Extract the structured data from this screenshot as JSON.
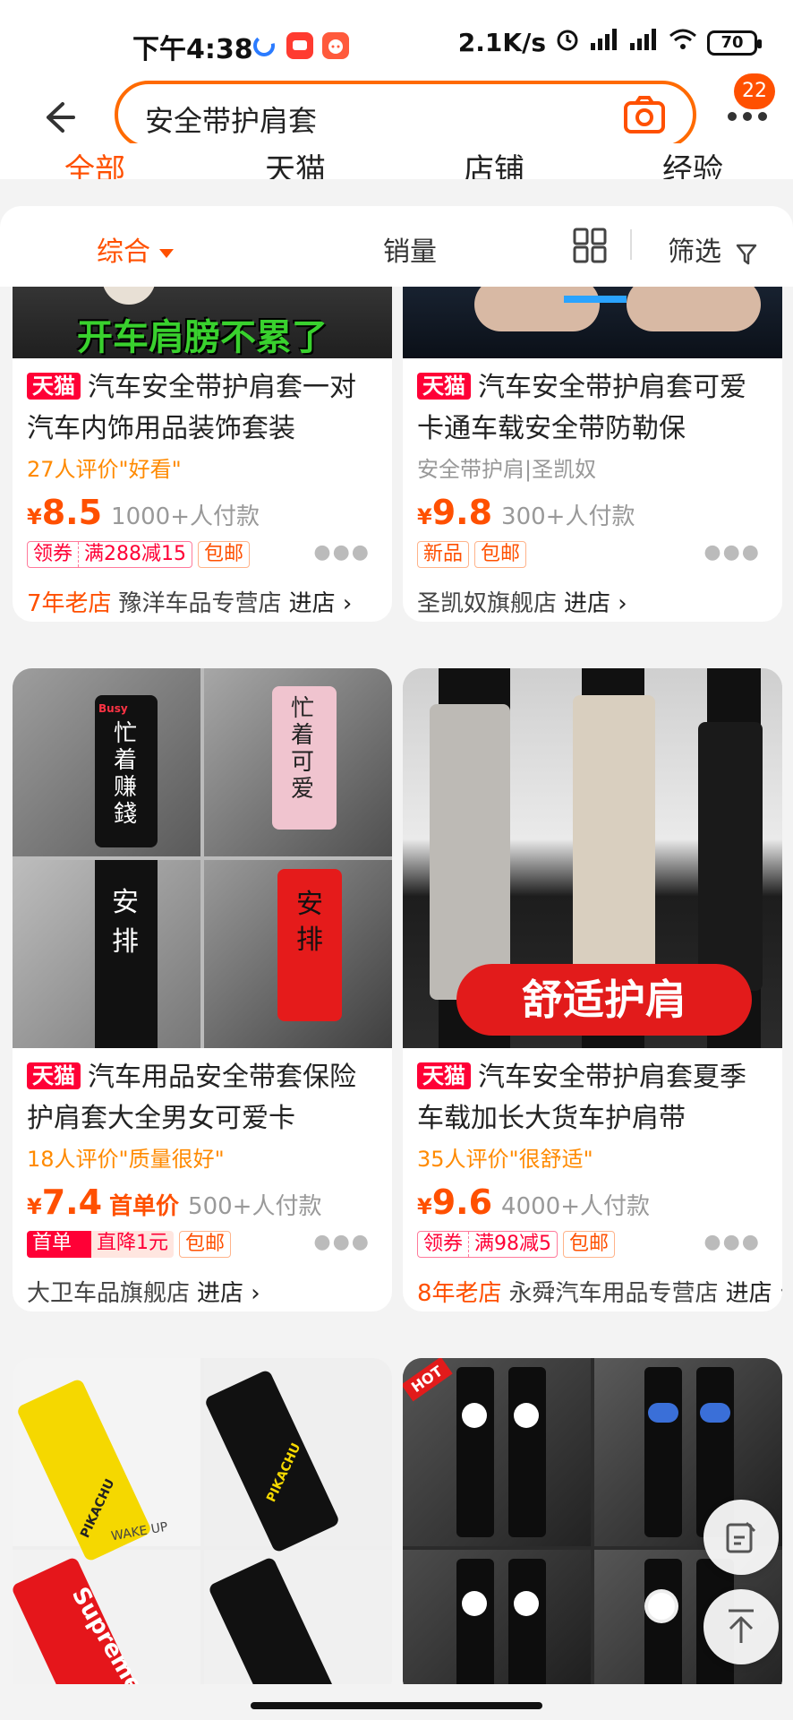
{
  "status_bar": {
    "time": "下午4:38",
    "network_speed": "2.1K/s",
    "battery": "70"
  },
  "search": {
    "query": "安全带护肩套",
    "notification_count": "22"
  },
  "top_tabs": [
    {
      "label": "全部"
    },
    {
      "label": "天猫"
    },
    {
      "label": "店铺"
    },
    {
      "label": "经验"
    }
  ],
  "sort_bar": {
    "comprehensive": "综合",
    "sales": "销量",
    "filter": "筛选"
  },
  "products": [
    {
      "banner_text": "开车肩膀不累了",
      "tmall_tag": "天猫",
      "title": "汽车安全带护肩套一对汽车内饰用品装饰套装",
      "review": "27人评价\"好看\"",
      "currency": "¥",
      "price": "8.5",
      "price_note": "",
      "sold": "1000+人付款",
      "coupon_left": "领券",
      "coupon_right": "满288减15",
      "tags": [
        "包邮"
      ],
      "shop_age": "7年老店",
      "shop_name": "豫洋车品专营店",
      "shop_enter": "进店 ›"
    },
    {
      "banner_text": "",
      "tmall_tag": "天猫",
      "title": "汽车安全带护肩套可爱卡通车载安全带防勒保",
      "review": "安全带护肩|圣凯奴",
      "currency": "¥",
      "price": "9.8",
      "price_note": "",
      "sold": "300+人付款",
      "tags": [
        "新品",
        "包邮"
      ],
      "shop_age": "",
      "shop_name": "圣凯奴旗舰店",
      "shop_enter": "进店 ›"
    },
    {
      "image_labels": [
        "Busy",
        "忙着赚錢",
        "忙着可爱",
        "安排",
        "安排"
      ],
      "tmall_tag": "天猫",
      "title": "汽车用品安全带套保险护肩套大全男女可爱卡",
      "review": "18人评价\"质量很好\"",
      "currency": "¥",
      "price": "7.4",
      "price_note": "首单价",
      "sold": "500+人付款",
      "first_order_left": "首单",
      "first_order_right": "直降1元",
      "tags": [
        "包邮"
      ],
      "shop_age": "",
      "shop_name": "大卫车品旗舰店",
      "shop_enter": "进店 ›"
    },
    {
      "banner_text": "舒适护肩",
      "tmall_tag": "天猫",
      "title": "汽车安全带护肩套夏季车载加长大货车护肩带",
      "review": "35人评价\"很舒适\"",
      "currency": "¥",
      "price": "9.6",
      "price_note": "",
      "sold": "4000+人付款",
      "coupon_left": "领券",
      "coupon_right": "满98减5",
      "tags": [
        "包邮"
      ],
      "shop_age": "8年老店",
      "shop_name": "永舜汽车用品专营店",
      "shop_enter": "进店 ›"
    },
    {
      "image_labels": [
        "PIKACHU",
        "PIKACHU",
        "Supreme",
        "WAKE UP"
      ]
    },
    {
      "hot_tag": "HOT"
    }
  ],
  "colors": {
    "accent": "#ff5000",
    "tmall_red": "#ff0036",
    "search_border": "#ff6a00"
  }
}
